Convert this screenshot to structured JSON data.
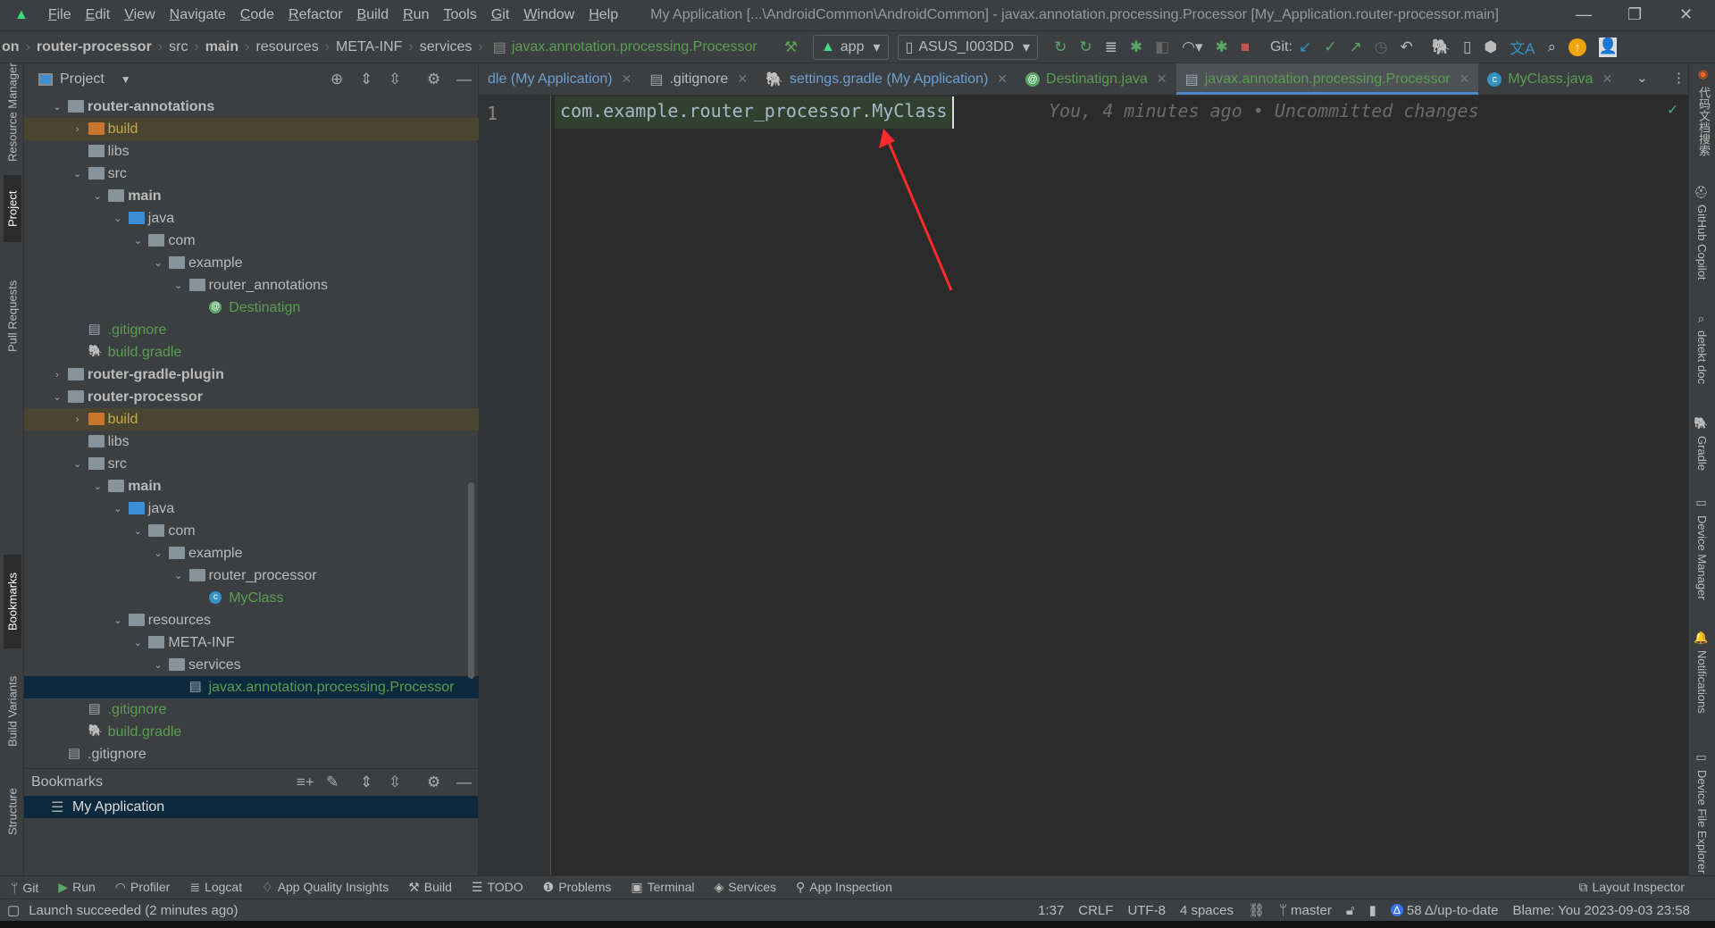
{
  "titlebar": {
    "menu": [
      "File",
      "Edit",
      "View",
      "Navigate",
      "Code",
      "Refactor",
      "Build",
      "Run",
      "Tools",
      "Git",
      "Window",
      "Help"
    ],
    "title": "My Application [...\\AndroidCommon\\AndroidCommon] - javax.annotation.processing.Processor [My_Application.router-processor.main]"
  },
  "navbar": {
    "crumbs": [
      "on",
      "router-processor",
      "src",
      "main",
      "resources",
      "META-INF",
      "services"
    ],
    "file": "javax.annotation.processing.Processor",
    "run_config": "app",
    "device": "ASUS_I003DD",
    "git_label": "Git:"
  },
  "left_strip": [
    "Resource Manager",
    "Project",
    "Pull Requests",
    "Bookmarks",
    "Build Variants",
    "Structure"
  ],
  "right_strip": [
    "代码文档搜索",
    "GitHub Copilot",
    "detekt doc",
    "Gradle",
    "Device Manager",
    "Notifications",
    "Device File Explorer"
  ],
  "project": {
    "title": "Project",
    "tree": [
      {
        "level": 0,
        "chev": "open",
        "icon": "module",
        "label": "router-annotations",
        "bold": true
      },
      {
        "level": 1,
        "chev": "closed",
        "icon": "folder-excluded",
        "label": "build",
        "style": "hl"
      },
      {
        "level": 1,
        "icon": "folder",
        "label": "libs"
      },
      {
        "level": 1,
        "chev": "open",
        "icon": "folder",
        "label": "src"
      },
      {
        "level": 2,
        "chev": "open",
        "icon": "folder",
        "label": "main",
        "bold": true
      },
      {
        "level": 3,
        "chev": "open",
        "icon": "folder-source",
        "label": "java"
      },
      {
        "level": 4,
        "chev": "open",
        "icon": "package",
        "label": "com"
      },
      {
        "level": 5,
        "chev": "open",
        "icon": "package",
        "label": "example"
      },
      {
        "level": 6,
        "chev": "open",
        "icon": "package",
        "label": "router_annotations"
      },
      {
        "level": 7,
        "icon": "annotation",
        "label": "Destinatign",
        "color": "#5a9e52"
      },
      {
        "level": 1,
        "icon": "gitignore",
        "label": ".gitignore",
        "color": "#5a9e52"
      },
      {
        "level": 1,
        "icon": "gradle",
        "label": "build.gradle",
        "color": "#5a9e52"
      },
      {
        "level": 0,
        "chev": "closed",
        "icon": "module",
        "label": "router-gradle-plugin",
        "bold": true
      },
      {
        "level": 0,
        "chev": "open",
        "icon": "module",
        "label": "router-processor",
        "bold": true
      },
      {
        "level": 1,
        "chev": "closed",
        "icon": "folder-excluded",
        "label": "build",
        "style": "hl"
      },
      {
        "level": 1,
        "icon": "folder",
        "label": "libs"
      },
      {
        "level": 1,
        "chev": "open",
        "icon": "folder",
        "label": "src"
      },
      {
        "level": 2,
        "chev": "open",
        "icon": "folder",
        "label": "main",
        "bold": true
      },
      {
        "level": 3,
        "chev": "open",
        "icon": "folder-source",
        "label": "java"
      },
      {
        "level": 4,
        "chev": "open",
        "icon": "package",
        "label": "com"
      },
      {
        "level": 5,
        "chev": "open",
        "icon": "package",
        "label": "example"
      },
      {
        "level": 6,
        "chev": "open",
        "icon": "package",
        "label": "router_processor"
      },
      {
        "level": 7,
        "icon": "class",
        "label": "MyClass",
        "color": "#5a9e52"
      },
      {
        "level": 3,
        "chev": "open",
        "icon": "folder-resources",
        "label": "resources"
      },
      {
        "level": 4,
        "chev": "open",
        "icon": "folder",
        "label": "META-INF"
      },
      {
        "level": 5,
        "chev": "open",
        "icon": "folder",
        "label": "services"
      },
      {
        "level": 6,
        "icon": "file",
        "label": "javax.annotation.processing.Processor",
        "color": "#5a9e52",
        "style": "sel"
      },
      {
        "level": 1,
        "icon": "gitignore",
        "label": ".gitignore",
        "color": "#5a9e52"
      },
      {
        "level": 1,
        "icon": "gradle",
        "label": "build.gradle",
        "color": "#5a9e52"
      },
      {
        "level": 0,
        "icon": "gitignore",
        "label": ".gitignore"
      }
    ]
  },
  "bookmarks": {
    "title": "Bookmarks",
    "items": [
      "My Application"
    ]
  },
  "editor": {
    "tabs": [
      {
        "label": "dle (My Application)",
        "icon": "gradle"
      },
      {
        "label": ".gitignore",
        "icon": "gitignore",
        "color": "#bbbbbb"
      },
      {
        "label": "settings.gradle (My Application)",
        "icon": "gradle"
      },
      {
        "label": "Destinatign.java",
        "icon": "annotation",
        "green": true
      },
      {
        "label": "javax.annotation.processing.Processor",
        "icon": "file",
        "green": true,
        "active": true
      },
      {
        "label": "MyClass.java",
        "icon": "class",
        "green": true
      }
    ],
    "line_number": "1",
    "code": "com.example.router_processor.MyClass",
    "blame": "You, 4 minutes ago • Uncommitted changes"
  },
  "bottom_tools": [
    "Git",
    "Run",
    "Profiler",
    "Logcat",
    "App Quality Insights",
    "Build",
    "TODO",
    "Problems",
    "Terminal",
    "Services",
    "App Inspection"
  ],
  "layout_inspector": "Layout Inspector",
  "status": {
    "message": "Launch succeeded (2 minutes ago)",
    "position": "1:37",
    "line_sep": "CRLF",
    "encoding": "UTF-8",
    "indent": "4 spaces",
    "branch": "master",
    "vcs": "58 Δ/up-to-date",
    "blame": "Blame: You 2023-09-03 23:58"
  },
  "colors": {
    "accent": "#4a88c7",
    "green_file": "#5a9e52",
    "annotation_arrow": "#ff2a2a"
  }
}
